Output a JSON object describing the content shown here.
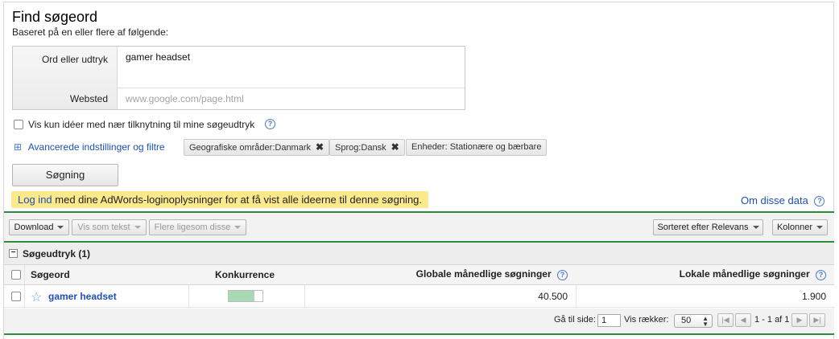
{
  "header": {
    "title": "Find søgeord",
    "subtitle": "Baseret på en eller flere af følgende:"
  },
  "form": {
    "words_label": "Ord eller udtryk",
    "words_value": "gamer headset",
    "website_label": "Websted",
    "website_placeholder": "www.google.com/page.html"
  },
  "options": {
    "close_match_label": "Vis kun idéer med nær tilknytning til mine søgeudtryk",
    "advanced_link": "Avancerede indstillinger og filtre",
    "filters": [
      {
        "label": "Geografiske områder:Danmark",
        "removable": true
      },
      {
        "label": "Sprog:Dansk",
        "removable": true
      },
      {
        "label": "Enheder: Stationære og bærbare",
        "removable": false
      }
    ],
    "remove_glyph": "✖"
  },
  "search_button": "Søgning",
  "notice": {
    "link": "Log ind",
    "text": " med dine AdWords-loginoplysninger for at få vist alle ideerne til denne søgning."
  },
  "about_link": "Om disse data",
  "toolbar": {
    "download": "Download",
    "view_as_text": "Vis som tekst",
    "more_like_these": "Flere ligesom disse",
    "sorted_by": "Sorteret efter Relevans",
    "columns": "Kolonner"
  },
  "group": {
    "toggle": "−",
    "title": "Søgeudtryk (1)"
  },
  "table": {
    "columns": [
      "Søgeord",
      "Konkurrence",
      "Globale månedlige søgninger",
      "Lokale månedlige søgninger"
    ],
    "rows": [
      {
        "keyword": "gamer headset",
        "competition": 0.75,
        "global": "40.500",
        "local": "1.900"
      }
    ]
  },
  "pager": {
    "goto_label": "Gå til side:",
    "goto_value": "1",
    "rows_label": "Vis rækker:",
    "rows_value": "50",
    "range": "1 - 1 af 1"
  },
  "colors": {
    "accent_green": "#2e8b3d",
    "competition_fill": "#a8d8b4",
    "link_blue": "#1f4fb5",
    "notice_bg": "#fbe98b"
  },
  "icons": {
    "help": "?",
    "plus": "⊞",
    "star": "☆",
    "first": "|◀",
    "prev": "◀",
    "next": "▶",
    "last": "▶|"
  }
}
